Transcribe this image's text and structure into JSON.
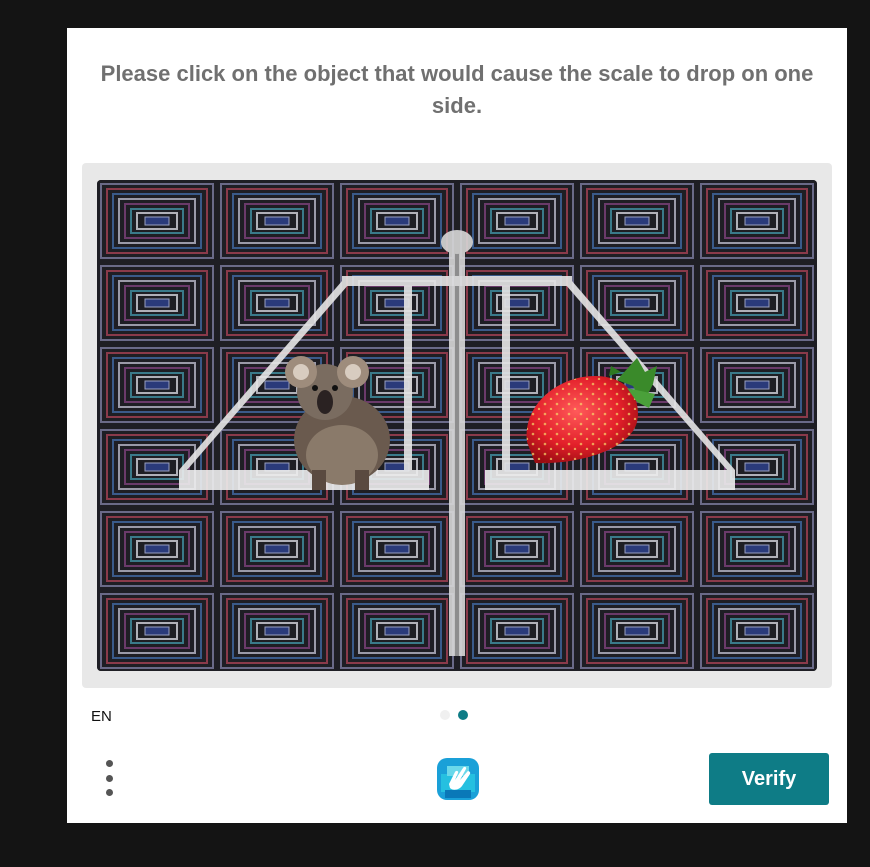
{
  "prompt": {
    "text": "Please click on the object that would cause the scale to drop on one side."
  },
  "challenge": {
    "objects": [
      {
        "name": "koala",
        "label": "koala"
      },
      {
        "name": "strawberry",
        "label": "strawberry"
      }
    ],
    "icons": {
      "scale": "balance-scale-icon",
      "left_object": "koala-image",
      "right_object": "strawberry-image"
    }
  },
  "footer": {
    "language": "EN",
    "pages": {
      "total": 2,
      "current": 2
    },
    "verify_label": "Verify",
    "menu_icon": "kebab-menu-icon",
    "logo_icon": "hcaptcha-hand-logo"
  },
  "colors": {
    "accent": "#0e7c86",
    "prompt_text": "#707070",
    "frame_bg": "#e8e8e8",
    "page_bg": "#141414"
  }
}
